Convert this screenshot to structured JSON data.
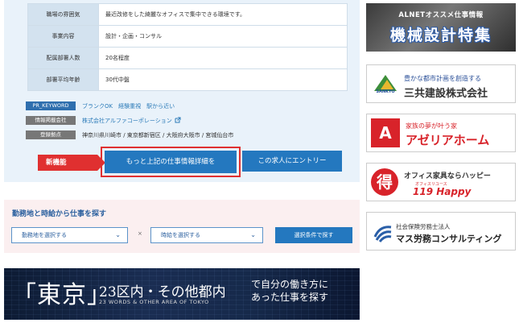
{
  "job_table": {
    "rows": [
      {
        "label": "職場の雰囲気",
        "value": "最近改修をした綺麗なオフィスで集中できる環境です。"
      },
      {
        "label": "事業内容",
        "value": "設計・企画・コンサル"
      },
      {
        "label": "配属部署人数",
        "value": "20名程度"
      },
      {
        "label": "部署平均年齢",
        "value": "30代中盤"
      }
    ]
  },
  "meta": {
    "keyword_tag": "PR_KEYWORD",
    "keywords": "ブランクOK　経験重視　駅から近い",
    "company_tag": "情報掲載会社",
    "company": "株式会社アルファコーポレーション",
    "location_tag": "登録拠点",
    "locations": "神奈川県川崎市 / 東京都新宿区 / 大阪府大阪市 / 宮城仙台市"
  },
  "actions": {
    "new_feature": "新機能",
    "detail_button": "もっと上記の仕事情報詳細を",
    "entry_button": "この求人にエントリー"
  },
  "search": {
    "title": "勤務地と時給から仕事を探す",
    "location_select": "勤務地を選択する",
    "times": "×",
    "wage_select": "時給を選択する",
    "submit": "選択条件で探す"
  },
  "banner": {
    "main": "「東京」",
    "sub": "23区内・その他都内",
    "english": "23 WORDS & OTHER AREA OF TOKYO",
    "tagline1": "で自分の働き方に",
    "tagline2": "あった仕事を探す"
  },
  "ads": {
    "ad1_small": "ALNETオススメ仕事情報",
    "ad1_big": "機械設計特集",
    "ad2_logo": "SANKYO",
    "ad2_line1": "豊かな都市計画を創造する",
    "ad2_line2": "三共建設株式会社",
    "ad3_badge": "A",
    "ad3_line1": "家族の夢が叶う家",
    "ad3_line2": "アゼリアホーム",
    "ad4_badge": "得",
    "ad4_line1": "オフィス家具ならハッピー",
    "ad4_line2": "オフィスリユース",
    "ad4_line3": "119 Happy",
    "ad5_line1": "社会保険労務士法人",
    "ad5_line2": "マス労務コンサルティング"
  },
  "colors": {
    "primary_blue": "#2478bf",
    "accent_red": "#e03030",
    "panel_blue": "#e9f2fa",
    "panel_pink": "#fbeff0"
  }
}
